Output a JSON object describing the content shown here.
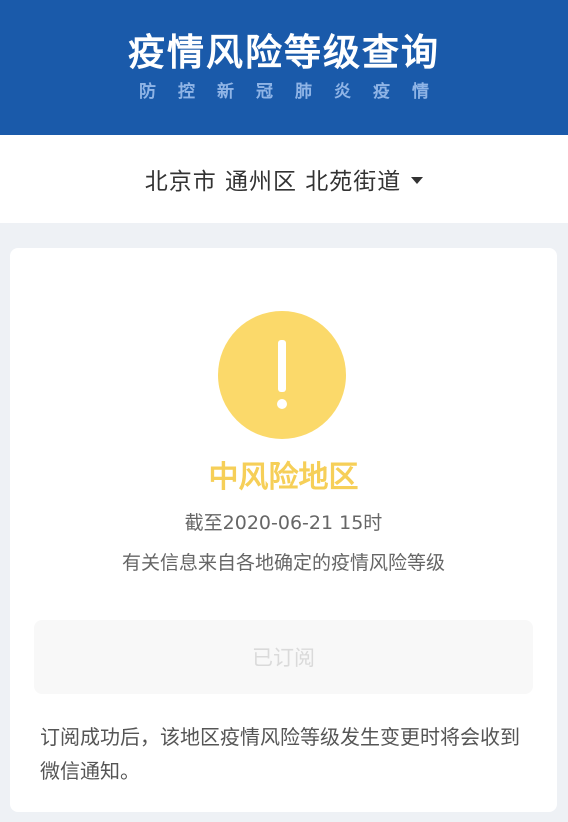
{
  "header": {
    "title": "疫情风险等级查询",
    "subtitle": "防控新冠肺炎疫情"
  },
  "location": {
    "label": "北京市 通州区 北苑街道",
    "icon": "caret-down-icon"
  },
  "status": {
    "icon": "warning-icon",
    "level": "中风险地区",
    "level_color": "#f6cf58",
    "as_of": "截至2020-06-21 15时",
    "source_note": "有关信息来自各地确定的疫情风险等级"
  },
  "subscribe": {
    "label": "已订阅",
    "state": "disabled"
  },
  "notice": {
    "text": "订阅成功后，该地区疫情风险等级发生变更时将会收到微信通知。"
  },
  "colors": {
    "header_bg": "#1a5aaa",
    "warning": "#fbd96a"
  }
}
